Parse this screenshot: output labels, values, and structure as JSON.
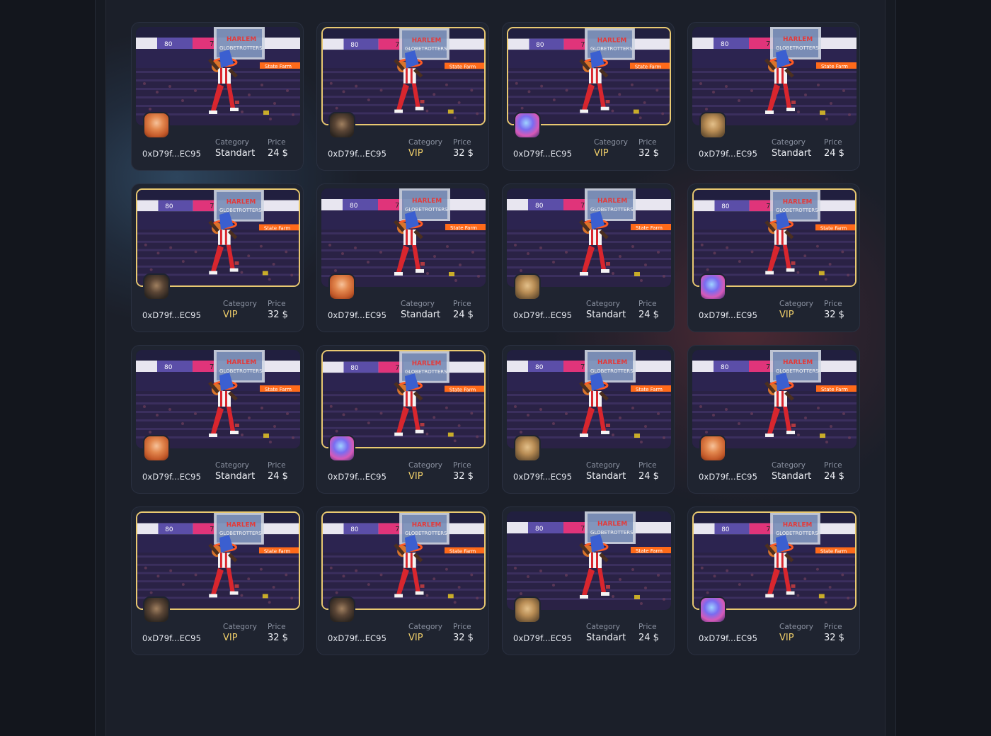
{
  "labels": {
    "category": "Category",
    "price": "Price"
  },
  "cards": [
    {
      "owner": "0xD79f...EC95",
      "category": "Standart",
      "price": "24 $",
      "avatar": "orange"
    },
    {
      "owner": "0xD79f...EC95",
      "category": "VIP",
      "price": "32 $",
      "avatar": "dark"
    },
    {
      "owner": "0xD79f...EC95",
      "category": "VIP",
      "price": "32 $",
      "avatar": "pink"
    },
    {
      "owner": "0xD79f...EC95",
      "category": "Standart",
      "price": "24 $",
      "avatar": "tan"
    },
    {
      "owner": "0xD79f...EC95",
      "category": "VIP",
      "price": "32 $",
      "avatar": "dark"
    },
    {
      "owner": "0xD79f...EC95",
      "category": "Standart",
      "price": "24 $",
      "avatar": "orange"
    },
    {
      "owner": "0xD79f...EC95",
      "category": "Standart",
      "price": "24 $",
      "avatar": "tan"
    },
    {
      "owner": "0xD79f...EC95",
      "category": "VIP",
      "price": "32 $",
      "avatar": "pink"
    },
    {
      "owner": "0xD79f...EC95",
      "category": "Standart",
      "price": "24 $",
      "avatar": "orange"
    },
    {
      "owner": "0xD79f...EC95",
      "category": "VIP",
      "price": "32 $",
      "avatar": "pink"
    },
    {
      "owner": "0xD79f...EC95",
      "category": "Standart",
      "price": "24 $",
      "avatar": "tan"
    },
    {
      "owner": "0xD79f...EC95",
      "category": "Standart",
      "price": "24 $",
      "avatar": "orange"
    },
    {
      "owner": "0xD79f...EC95",
      "category": "VIP",
      "price": "32 $",
      "avatar": "dark"
    },
    {
      "owner": "0xD79f...EC95",
      "category": "VIP",
      "price": "32 $",
      "avatar": "dark"
    },
    {
      "owner": "0xD79f...EC95",
      "category": "Standart",
      "price": "24 $",
      "avatar": "tan"
    },
    {
      "owner": "0xD79f...EC95",
      "category": "VIP",
      "price": "32 $",
      "avatar": "pink"
    }
  ],
  "colors": {
    "vip_accent": "#f0cf6a",
    "vip_border": "#e9c971",
    "card_bg": "#1f2430",
    "page_bg": "#1b1f29"
  },
  "icons": {
    "nft_image": "basketball-dunk-image",
    "owner_avatar": "user-avatar-icon"
  }
}
